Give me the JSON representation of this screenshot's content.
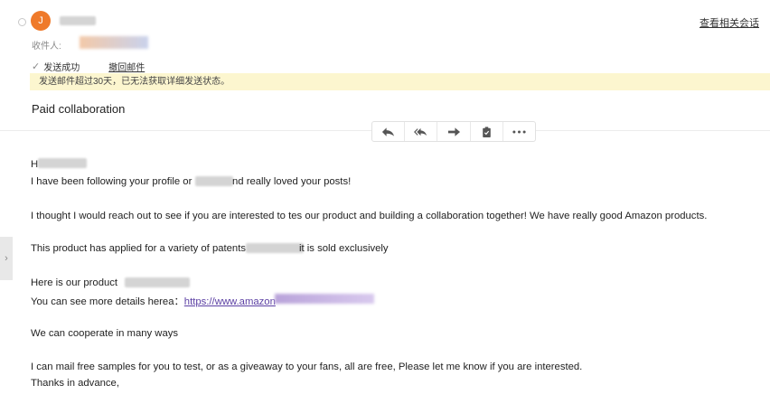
{
  "header": {
    "avatar_letter": "J",
    "view_conversation": "查看相关会话",
    "recipients_label": "收件人:",
    "sent_status": "发送成功",
    "recall_label": "撤回邮件",
    "banner_text": "发送邮件超过30天，已无法获取详细发送状态。"
  },
  "email": {
    "subject": "Paid collaboration",
    "greeting": "H",
    "line1_a": "I have been following your profile or",
    "line1_b": "nd really loved your posts!",
    "line2": "I thought I would reach out to see if you are interested to tes our product and building a collaboration together! We have really good Amazon products.",
    "line3_a": "This product has applied for a variety of patents",
    "line3_b": "it is sold exclusively",
    "line4": "Here is our product",
    "line5_a": "You can see more details herea：",
    "line5_link": "https://www.amazon",
    "line6": "We can cooperate in many ways",
    "line7": "I can mail free samples for you to test, or as a giveaway to your fans, all are free,  Please let me know if you are interested.",
    "line8": "Thanks in advance,"
  },
  "toolbar": {
    "icons": [
      "reply-icon",
      "reply-all-icon",
      "forward-icon",
      "clipboard-icon",
      "more-icon"
    ]
  },
  "colors": {
    "avatar": "#ef7a2a",
    "banner": "#fcf6cf",
    "link": "#5b3fa3"
  }
}
